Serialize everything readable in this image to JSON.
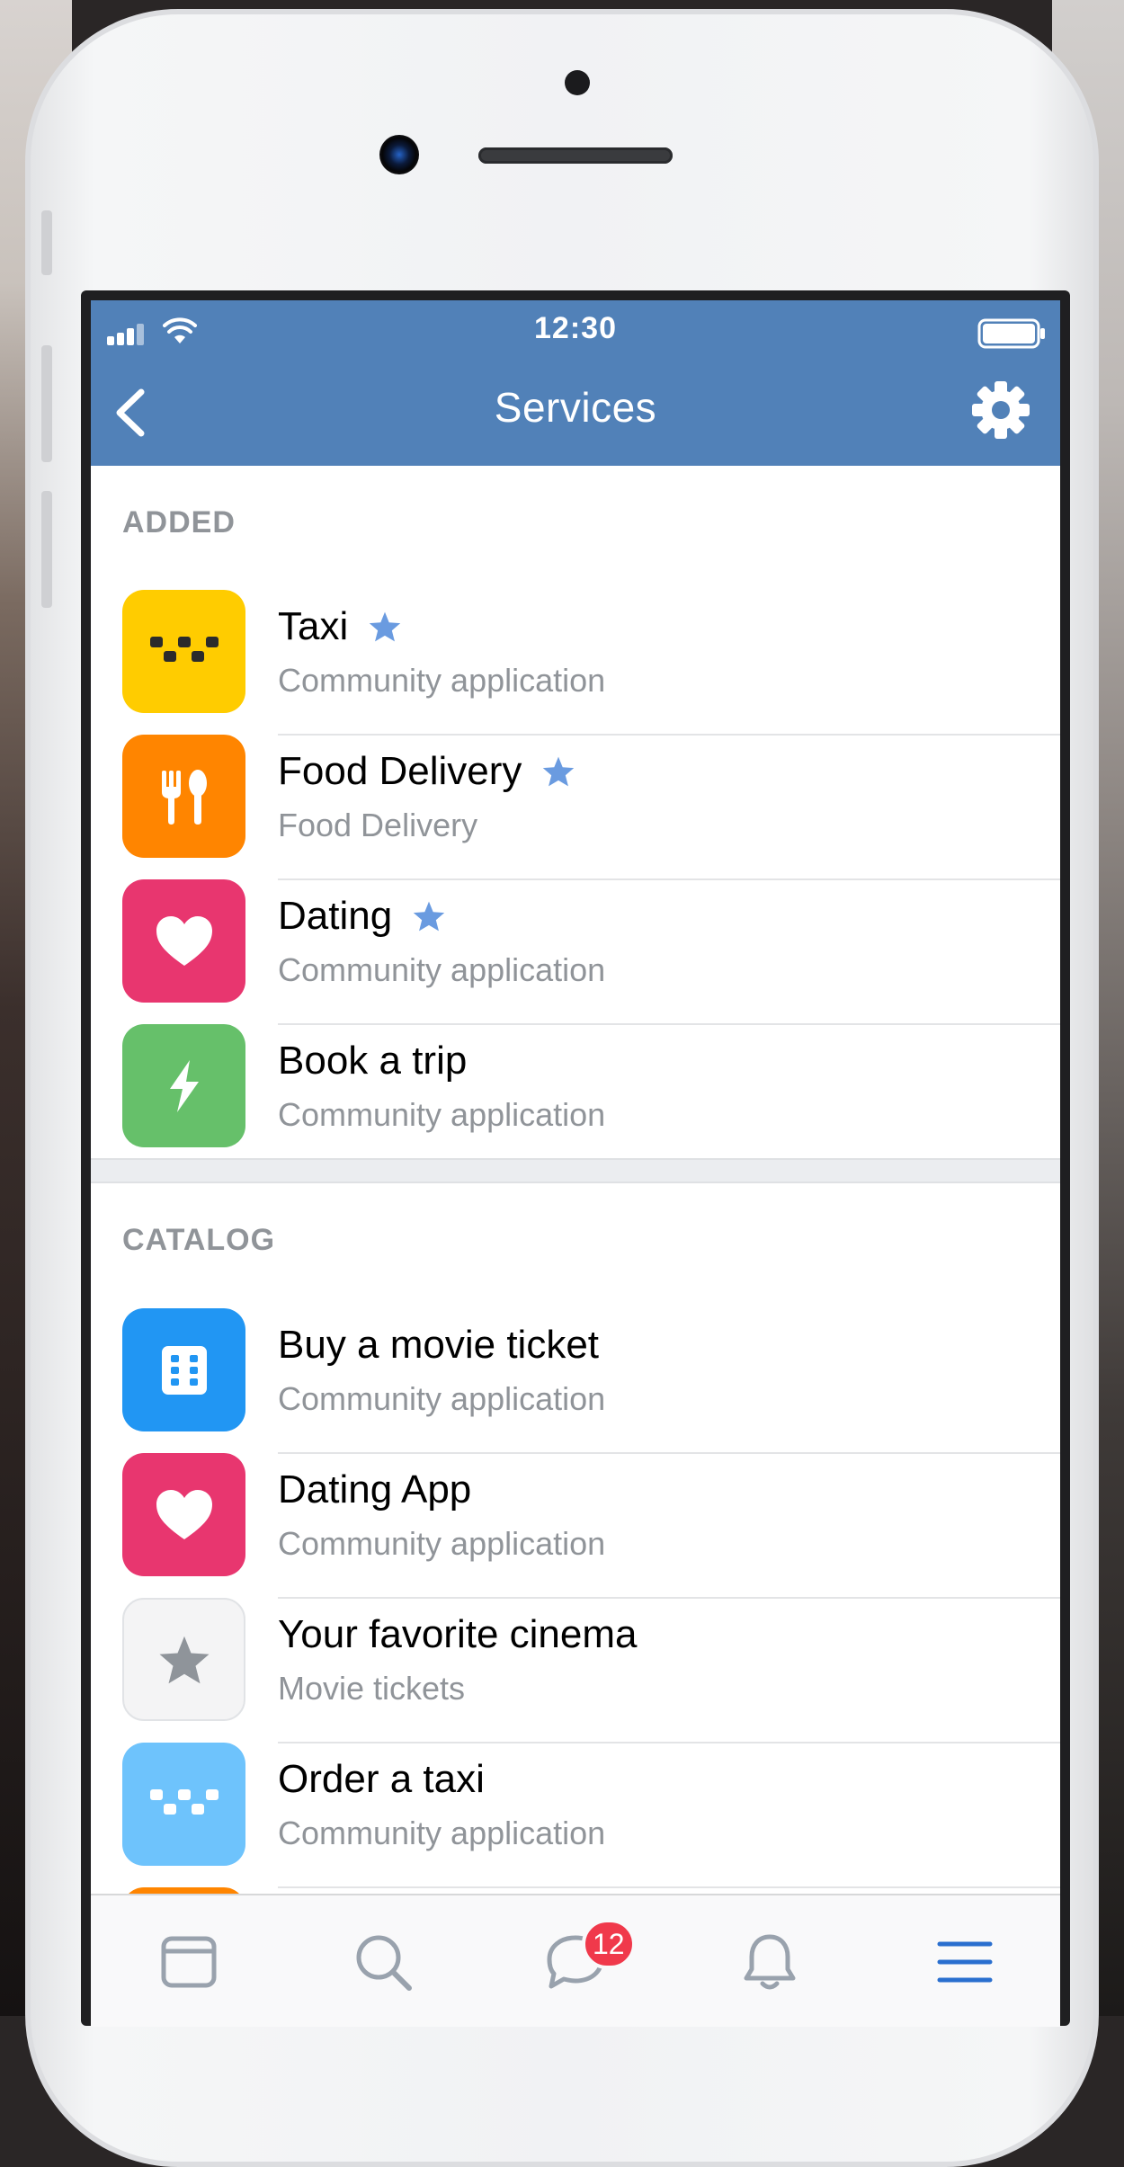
{
  "status_bar": {
    "time": "12:30"
  },
  "header": {
    "title": "Services"
  },
  "sections": {
    "added": {
      "label": "ADDED",
      "items": [
        {
          "title": "Taxi",
          "subtitle": "Community application",
          "icon": "taxi-icon",
          "color": "#ffcc00",
          "starred": true
        },
        {
          "title": "Food Delivery",
          "subtitle": "Food Delivery",
          "icon": "fork-spoon-icon",
          "color": "#ff8500",
          "starred": true
        },
        {
          "title": "Dating",
          "subtitle": "Community application",
          "icon": "heart-icon",
          "color": "#e8366f",
          "starred": true
        },
        {
          "title": "Book a trip",
          "subtitle": "Community application",
          "icon": "lightning-icon",
          "color": "#66c06a",
          "starred": false
        }
      ]
    },
    "catalog": {
      "label": "CATALOG",
      "items": [
        {
          "title": "Buy a movie ticket",
          "subtitle": "Community application",
          "icon": "ticket-icon",
          "color": "#2196f3"
        },
        {
          "title": "Dating App",
          "subtitle": "Community application",
          "icon": "heart-icon",
          "color": "#e8366f"
        },
        {
          "title": "Your favorite cinema",
          "subtitle": "Movie tickets",
          "icon": "star-icon",
          "color": "#f4f4f5"
        },
        {
          "title": "Order a taxi",
          "subtitle": "Community application",
          "icon": "taxi-icon",
          "color": "#6ec3fc"
        }
      ]
    }
  },
  "tabbar": {
    "tabs": [
      "feed-icon",
      "search-icon",
      "messages-icon",
      "notifications-icon",
      "menu-icon"
    ],
    "messages_badge": "12",
    "active": "menu-icon"
  },
  "colors": {
    "accent": "#5181b8",
    "star": "#6a9be0",
    "secondary_text": "#909499"
  }
}
